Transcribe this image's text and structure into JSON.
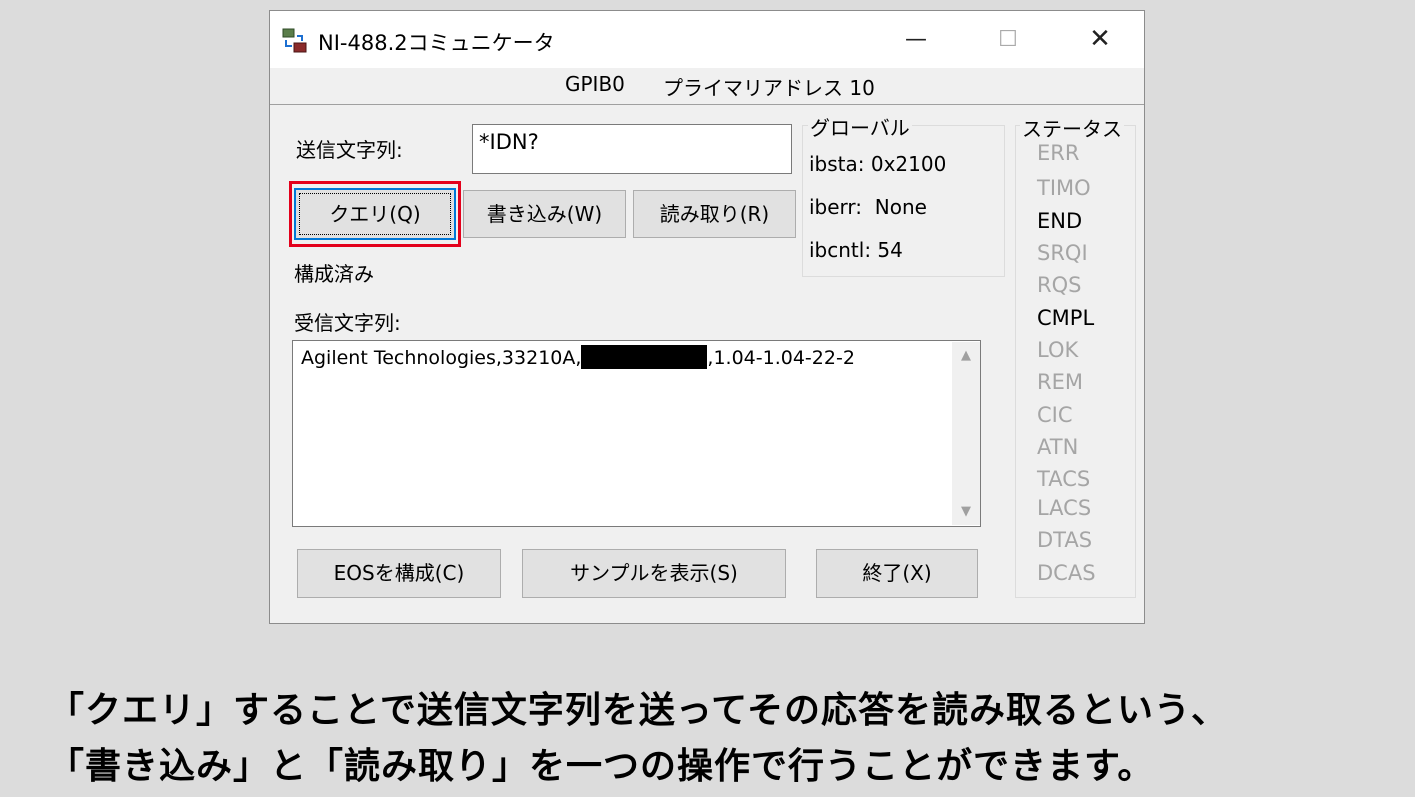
{
  "window": {
    "title": "NI-488.2コミュニケータ",
    "minimize_icon": "minimize-icon",
    "maximize_icon": "maximize-icon",
    "close_icon": "close-icon",
    "minimize_glyph": "—",
    "maximize_glyph": "☐",
    "close_glyph": "✕"
  },
  "device": {
    "board": "GPIB0",
    "address": "プライマリアドレス 10"
  },
  "send": {
    "label": "送信文字列:",
    "value": "*IDN?"
  },
  "buttons": {
    "query": "クエリ(Q)",
    "write": "書き込み(W)",
    "read": "読み取り(R)",
    "eos": "EOSを構成(C)",
    "sample": "サンプルを表示(S)",
    "exit": "終了(X)"
  },
  "status_text": "構成済み",
  "receive": {
    "label": "受信文字列:",
    "value_prefix": "Agilent Technologies,33210A,",
    "value_suffix": ",1.04-1.04-22-2"
  },
  "global": {
    "title": "グローバル",
    "ibsta": "ibsta: 0x2100",
    "iberr": "iberr:  None",
    "ibcntl": "ibcntl: 54"
  },
  "status": {
    "title": "ステータス",
    "items": [
      {
        "label": "ERR",
        "active": false
      },
      {
        "label": "TIMO",
        "active": false
      },
      {
        "label": "END",
        "active": true
      },
      {
        "label": "SRQI",
        "active": false
      },
      {
        "label": "RQS",
        "active": false
      },
      {
        "label": "CMPL",
        "active": true
      },
      {
        "label": "LOK",
        "active": false
      },
      {
        "label": "REM",
        "active": false
      },
      {
        "label": "CIC",
        "active": false
      },
      {
        "label": "ATN",
        "active": false
      },
      {
        "label": "TACS",
        "active": false
      },
      {
        "label": "LACS",
        "active": false
      },
      {
        "label": "DTAS",
        "active": false
      },
      {
        "label": "DCAS",
        "active": false
      }
    ]
  },
  "caption": {
    "line1": "「クエリ」することで送信文字列を送ってその応答を読み取るという、",
    "line2": "「書き込み」と「読み取り」を一つの操作で行うことができます。"
  },
  "colors": {
    "highlight": "#e3001b",
    "default_button_border": "#0078d7",
    "inactive_status": "#a5a5a5"
  }
}
